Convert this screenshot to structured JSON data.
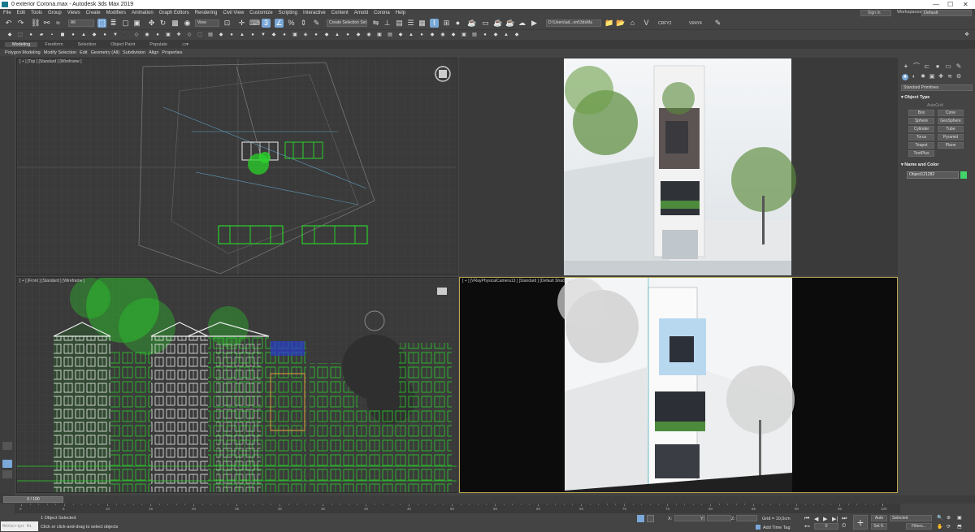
{
  "window": {
    "title": "0 exterior Corona.max - Autodesk 3ds Max 2019",
    "min": "—",
    "max": "☐",
    "close": "✕"
  },
  "menu": [
    "File",
    "Edit",
    "Tools",
    "Group",
    "Views",
    "Create",
    "Modifiers",
    "Animation",
    "Graph Editors",
    "Rendering",
    "Civil View",
    "Customize",
    "Scripting",
    "Interactive",
    "Content",
    "Arnold",
    "Corona",
    "Help"
  ],
  "account": {
    "sign_in": "Sign In",
    "workspaces_label": "Workspaces:",
    "workspace_value": "Default"
  },
  "toolbar": {
    "selection_filter": "All",
    "ref_coord": "View",
    "named_selection": "Create Selection Set",
    "project_path": "D:\\Users\\ad...ent\\3dsMa",
    "render_label_1": "CRFY2",
    "render_label_2": "VR4Y4"
  },
  "ribbon": {
    "tabs": [
      "Modeling",
      "Freeform",
      "Selection",
      "Object Paint",
      "Populate"
    ],
    "active_tab": "Modeling",
    "sub_items": [
      "Polygon Modeling",
      "Modify Selection",
      "Edit",
      "Geometry (All)",
      "Subdivision",
      "Align",
      "Properties"
    ]
  },
  "viewports": {
    "top": "[ + ] [Top ] [Standard ] [Wireframe ]",
    "front": "[ + ] [Front ] [Standard ] [Wireframe ]",
    "camera": "[ + ] [VRayPhysicalCamera13 ] [Standard ] [Default Shading ]"
  },
  "command_panel": {
    "dropdown": "Standard Primitives",
    "object_type_title": "Object Type",
    "autogrid": "AutoGrid",
    "buttons": [
      "Box",
      "Cone",
      "Sphere",
      "GeoSphere",
      "Cylinder",
      "Tube",
      "Torus",
      "Pyramid",
      "Teapot",
      "Plane",
      "TextPlus"
    ],
    "name_color_title": "Name and Color",
    "object_name": "Object121282",
    "object_color": "#44d36a"
  },
  "timeline": {
    "frame_display": "0 / 100",
    "ticks": [
      "0",
      "5",
      "10",
      "15",
      "20",
      "25",
      "30",
      "35",
      "40",
      "45",
      "50",
      "55",
      "60",
      "65",
      "70",
      "75",
      "80",
      "85",
      "90",
      "95",
      "100"
    ]
  },
  "status": {
    "maxscript": "MAXScript Mi",
    "selected": "1 Object Selected",
    "prompt": "Click or click-and-drag to select objects",
    "x_label": "X:",
    "y_label": "Y:",
    "z_label": "Z:",
    "grid": "Grid = 10,0cm",
    "add_time_tag": "Add Time Tag",
    "auto": "Auto",
    "set_k": "Set K.",
    "selected_dd": "Selected",
    "filters": "Filters...",
    "frame_field": "0"
  },
  "colors": {
    "accent": "#7aa8d8",
    "wire_green": "#2ad12a",
    "bg": "#444444"
  }
}
